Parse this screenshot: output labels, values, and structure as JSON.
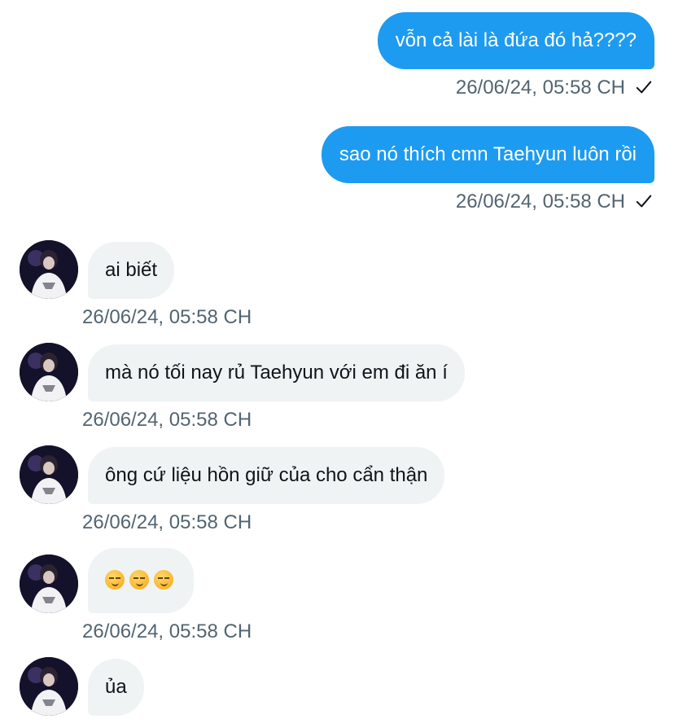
{
  "messages": [
    {
      "direction": "out",
      "text": "vỗn cả lài là đứa đó hả????",
      "time": "26/06/24, 05:58 CH",
      "status": "sent-check-icon"
    },
    {
      "direction": "out",
      "text": "sao nó thích cmn Taehyun luôn rồi",
      "time": "26/06/24, 05:58 CH",
      "status": "sent-check-icon"
    },
    {
      "direction": "in",
      "text": "ai biết",
      "time": "26/06/24, 05:58 CH"
    },
    {
      "direction": "in",
      "text": "mà nó tối nay rủ Taehyun với em đi ăn í",
      "time": "26/06/24, 05:58 CH"
    },
    {
      "direction": "in",
      "text": "ông cứ liệu hồn giữ của cho cẩn thận",
      "time": "26/06/24, 05:58 CH"
    },
    {
      "direction": "in",
      "emoji": [
        "smirking-face-emoji",
        "smirking-face-emoji",
        "smirking-face-emoji"
      ],
      "time": "26/06/24, 05:58 CH"
    },
    {
      "direction": "in",
      "text": "ủa"
    }
  ],
  "colors": {
    "outgoing_bubble": "#1d9bf0",
    "incoming_bubble": "#eff3f4",
    "timestamp": "#536471"
  }
}
